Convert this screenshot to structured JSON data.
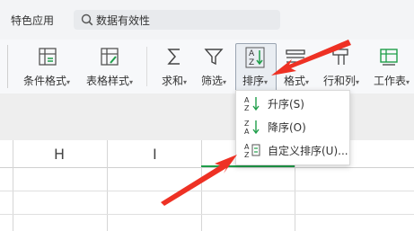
{
  "menu": {
    "special_apps": "特色应用"
  },
  "search": {
    "text": "数据有效性"
  },
  "ribbon": {
    "conditional_format": "条件格式",
    "table_style": "表格样式",
    "sum": "求和",
    "filter": "筛选",
    "sort": "排序",
    "format": "格式",
    "rows_cols": "行和列",
    "worksheet": "工作表"
  },
  "sheet": {
    "columns": [
      "H",
      "I"
    ]
  },
  "sort_menu": {
    "items": [
      {
        "label": "升序(S)",
        "icon": "sort-ascending-icon"
      },
      {
        "label": "降序(O)",
        "icon": "sort-descending-icon"
      },
      {
        "label": "自定义排序(U)...",
        "icon": "custom-sort-icon"
      }
    ]
  },
  "colors": {
    "arrow": "#ee3124",
    "active_green": "#1f9e4a"
  }
}
